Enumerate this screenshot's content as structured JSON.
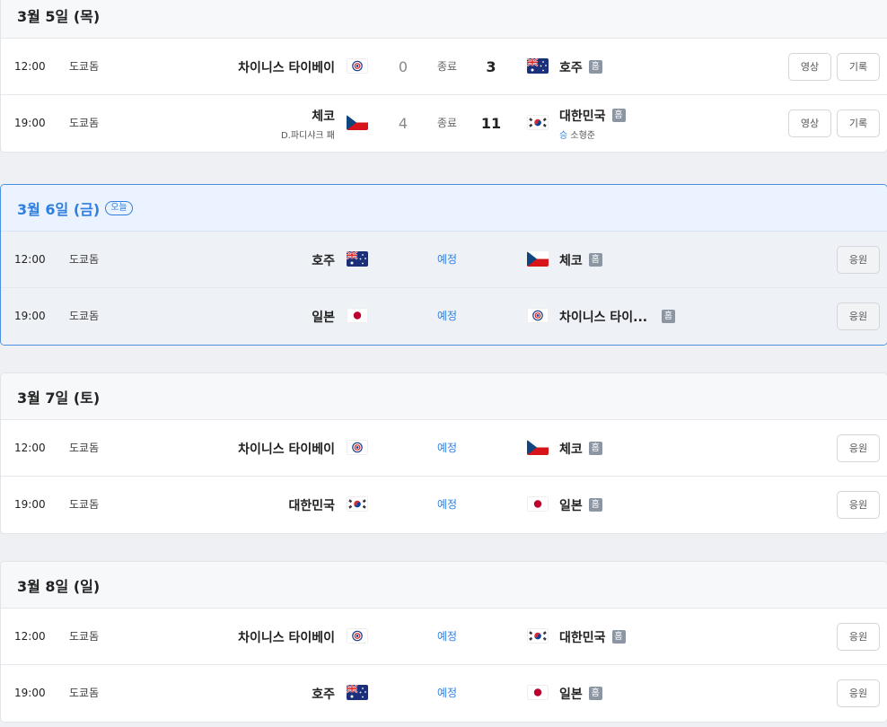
{
  "days": [
    {
      "date_label": "3월 5일 (목)",
      "today_badge": "",
      "games": [
        {
          "time": "12:00",
          "venue": "도쿄돔",
          "away": "차이니스 타이베이",
          "away_pitcher": "",
          "away_score": "0",
          "status": "종료",
          "home_score": "3",
          "home": "호주",
          "home_badge": "홈",
          "home_pitcher": "",
          "buttons": [
            "영상",
            "기록"
          ]
        },
        {
          "time": "19:00",
          "venue": "도쿄돔",
          "away": "체코",
          "away_pitcher": "D.파디샤크 패",
          "away_score": "4",
          "status": "종료",
          "home_score": "11",
          "home": "대한민국",
          "home_badge": "홈",
          "home_pitcher_result": "승",
          "home_pitcher": "소형준",
          "buttons": [
            "영상",
            "기록"
          ]
        }
      ]
    },
    {
      "date_label": "3월 6일 (금)",
      "today_badge": "오늘",
      "games": [
        {
          "time": "12:00",
          "venue": "도쿄돔",
          "away": "호주",
          "status": "예정",
          "home": "체코",
          "home_badge": "홈",
          "buttons": [
            "응원"
          ]
        },
        {
          "time": "19:00",
          "venue": "도쿄돔",
          "away": "일본",
          "status": "예정",
          "home": "차이니스 타이...",
          "home_badge": "홈",
          "buttons": [
            "응원"
          ]
        }
      ]
    },
    {
      "date_label": "3월 7일 (토)",
      "today_badge": "",
      "games": [
        {
          "time": "12:00",
          "venue": "도쿄돔",
          "away": "차이니스 타이베이",
          "status": "예정",
          "home": "체코",
          "home_badge": "홈",
          "buttons": [
            "응원"
          ]
        },
        {
          "time": "19:00",
          "venue": "도쿄돔",
          "away": "대한민국",
          "status": "예정",
          "home": "일본",
          "home_badge": "홈",
          "buttons": [
            "응원"
          ]
        }
      ]
    },
    {
      "date_label": "3월 8일 (일)",
      "today_badge": "",
      "games": [
        {
          "time": "12:00",
          "venue": "도쿄돔",
          "away": "차이니스 타이베이",
          "status": "예정",
          "home": "대한민국",
          "home_badge": "홈",
          "buttons": [
            "응원"
          ]
        },
        {
          "time": "19:00",
          "venue": "도쿄돔",
          "away": "호주",
          "status": "예정",
          "home": "일본",
          "home_badge": "홈",
          "buttons": [
            "응원"
          ]
        }
      ]
    }
  ],
  "colors": {
    "accent": "#2f7fe0",
    "today_border": "#4a8fe0",
    "today_header_bg": "#eaf3ff",
    "home_badge_bg": "#8c96a3"
  },
  "flags": {
    "chinese-taipei": "chinese-taipei-flag-icon",
    "australia": "australia-flag-icon",
    "czechia": "czechia-flag-icon",
    "korea": "korea-flag-icon",
    "japan": "japan-flag-icon"
  }
}
